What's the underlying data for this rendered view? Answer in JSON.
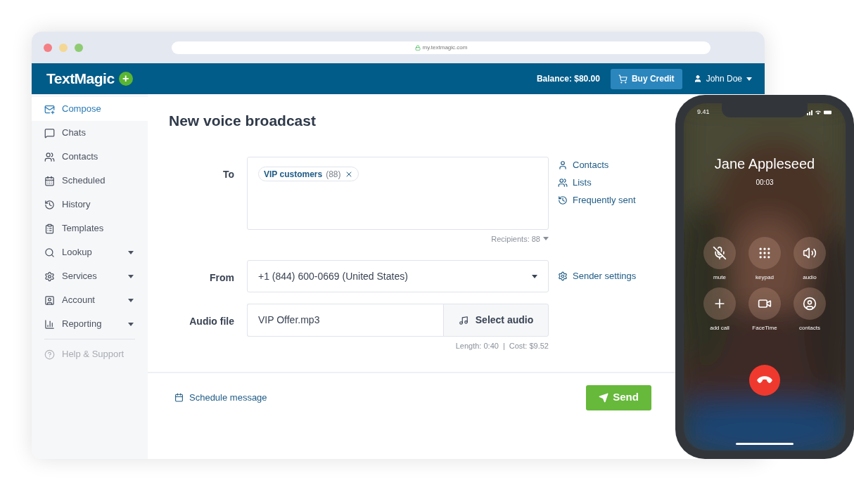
{
  "browser": {
    "url": "my.textmagic.com"
  },
  "header": {
    "logo": "TextMagic",
    "logo_badge": "+",
    "balance": "Balance: $80.00",
    "buy_button": "Buy Credit",
    "user": "John Doe"
  },
  "sidebar": {
    "items": [
      {
        "label": "Compose",
        "selected": true,
        "expandable": false,
        "disabled": false
      },
      {
        "label": "Chats",
        "selected": false,
        "expandable": false,
        "disabled": false
      },
      {
        "label": "Contacts",
        "selected": false,
        "expandable": false,
        "disabled": false
      },
      {
        "label": "Scheduled",
        "selected": false,
        "expandable": false,
        "disabled": false
      },
      {
        "label": "History",
        "selected": false,
        "expandable": false,
        "disabled": false
      },
      {
        "label": "Templates",
        "selected": false,
        "expandable": false,
        "disabled": false
      },
      {
        "label": "Lookup",
        "selected": false,
        "expandable": true,
        "disabled": false
      },
      {
        "label": "Services",
        "selected": false,
        "expandable": true,
        "disabled": false
      },
      {
        "label": "Account",
        "selected": false,
        "expandable": true,
        "disabled": false
      },
      {
        "label": "Reporting",
        "selected": false,
        "expandable": true,
        "disabled": false
      },
      {
        "label": "Help & Support",
        "selected": false,
        "expandable": false,
        "disabled": true
      }
    ]
  },
  "main": {
    "title": "New voice broadcast",
    "to": {
      "label": "To",
      "chips": [
        {
          "label": "VIP customers",
          "count": "(88)"
        }
      ],
      "recipients": "Recipients: 88",
      "links": [
        "Contacts",
        "Lists",
        "Frequently sent"
      ]
    },
    "from": {
      "label": "From",
      "value": "+1 (844) 600-0669 (United States)",
      "link": "Sender settings"
    },
    "audio": {
      "label": "Audio file",
      "value": "VIP Offer.mp3",
      "button": "Select audio",
      "length": "Length: 0:40",
      "cost": "Cost: $9.52",
      "separator": "|"
    },
    "schedule_link": "Schedule message",
    "send_button": "Send"
  },
  "phone": {
    "time": "9.41",
    "caller": "Jane Appleseed",
    "duration": "00:03",
    "buttons": [
      {
        "label": "mute"
      },
      {
        "label": "keypad"
      },
      {
        "label": "audio"
      },
      {
        "label": "add call"
      },
      {
        "label": "FaceTime"
      },
      {
        "label": "contacts"
      }
    ]
  }
}
